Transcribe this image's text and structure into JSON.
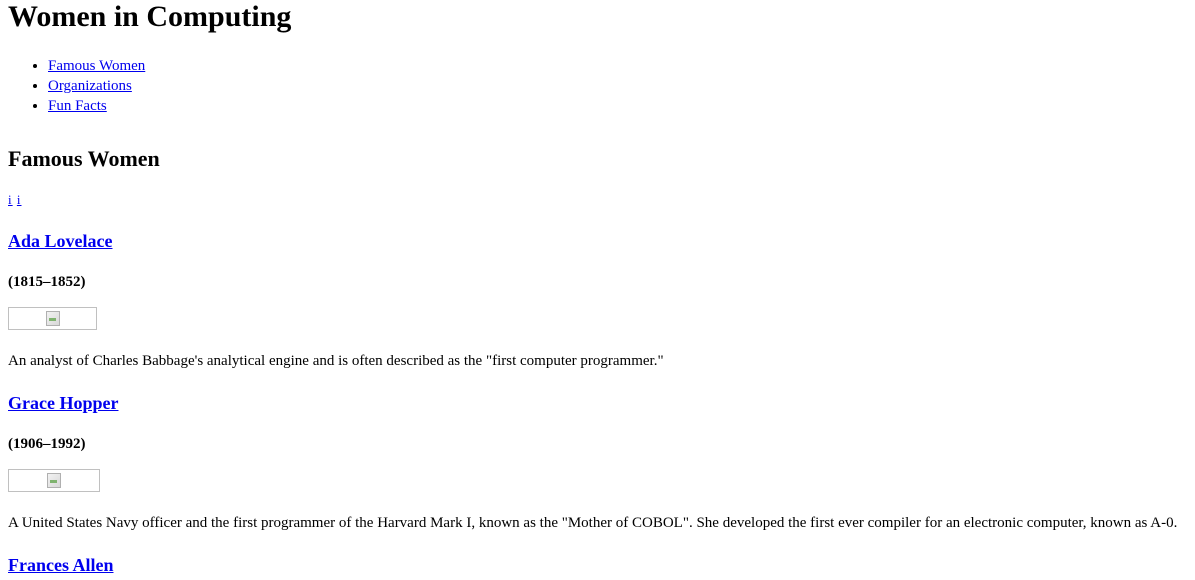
{
  "page": {
    "title": "Women in Computing"
  },
  "nav": {
    "items": [
      {
        "label": "Famous Women"
      },
      {
        "label": "Organizations"
      },
      {
        "label": "Fun Facts"
      }
    ]
  },
  "section": {
    "title": "Famous Women",
    "controls": [
      "i",
      "i"
    ]
  },
  "people": [
    {
      "name": "Ada Lovelace",
      "years": "(1815–1852)",
      "description": "An analyst of Charles Babbage's analytical engine and is often described as the \"first computer programmer.\""
    },
    {
      "name": "Grace Hopper",
      "years": "(1906–1992)",
      "description": "A United States Navy officer and the first programmer of the Harvard Mark I, known as the \"Mother of COBOL\". She developed the first ever compiler for an electronic computer, known as A-0."
    },
    {
      "name": "Frances Allen"
    }
  ],
  "colors": {
    "link": "#0000ee",
    "text": "#000000",
    "background": "#ffffff"
  }
}
